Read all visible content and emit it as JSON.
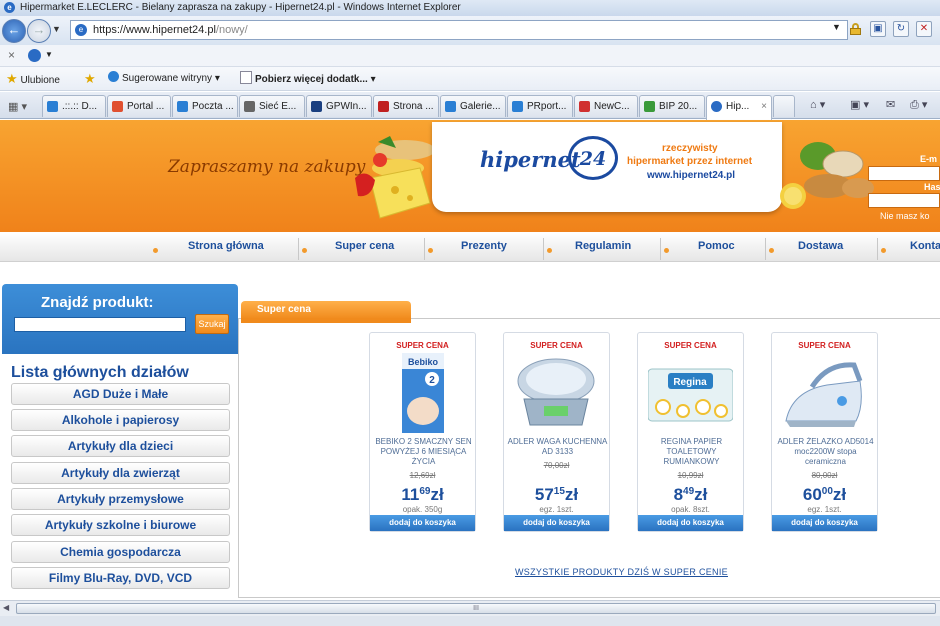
{
  "browser": {
    "window_title": "Hipermarket E.LECLERC - Bielany zaprasza na zakupy - Hipernet24.pl - Windows Internet Explorer",
    "url_prefix": "https://www.",
    "url_domain": "hipernet24.pl",
    "url_path": "/nowy/",
    "favorites_label": "Ulubione",
    "fav_suggested": "Sugerowane witryny",
    "fav_addons": "Pobierz więcej dodatk...",
    "tabs": [
      {
        "label": ".::.:: D..."
      },
      {
        "label": "Portal ..."
      },
      {
        "label": "Poczta ..."
      },
      {
        "label": "Sieć E..."
      },
      {
        "label": "GPWIn..."
      },
      {
        "label": "Strona ..."
      },
      {
        "label": "Galerie..."
      },
      {
        "label": "PRport..."
      },
      {
        "label": "NewC..."
      },
      {
        "label": "BIP 20..."
      },
      {
        "label": "Hip..."
      }
    ],
    "scroll_grip": "III"
  },
  "header": {
    "welcome": "Zapraszamy na zakupy",
    "logo_word": "hipernet",
    "logo_number": "24",
    "tagline_1": "rzeczywisty",
    "tagline_2": "hipermarket przez internet",
    "tagline_3": "www.hipernet24.pl",
    "login_email_label": "E-m",
    "login_pass_label": "Has",
    "login_note": "Nie masz ko"
  },
  "menu": [
    "Strona główna",
    "Super cena",
    "Prezenty",
    "Regulamin",
    "Pomoc",
    "Dostawa",
    "Konta"
  ],
  "search": {
    "title": "Znajdź produkt:",
    "button": "Szukaj",
    "value": ""
  },
  "categories": {
    "title": "Lista głównych działów",
    "items": [
      "AGD Duże i Małe",
      "Alkohole i papierosy",
      "Artykuły dla dzieci",
      "Artykuły dla zwierząt",
      "Artykuły przemysłowe",
      "Artykuły szkolne i biurowe",
      "Chemia gospodarcza",
      "Filmy Blu-Ray, DVD, VCD"
    ]
  },
  "main": {
    "section_tab": "Super cena",
    "all_link": "WSZYSTKIE PRODUKTY DZIŚ W SUPER CENIE",
    "products": [
      {
        "badge": "SUPER CENA",
        "name": "BEBIKO 2 SMACZNY SEN POWYŻEJ 6 MIESIĄCA ŻYCIA",
        "old_price": "12,69zł",
        "price_int": "11",
        "price_dec": "69",
        "currency": "zł",
        "pack": "opak. 350g",
        "add": "dodaj do koszyka",
        "image": "milk-formula-box"
      },
      {
        "badge": "SUPER CENA",
        "name": "ADLER WAGA KUCHENNA AD 3133",
        "old_price": "70,00zł",
        "price_int": "57",
        "price_dec": "15",
        "currency": "zł",
        "pack": "egz. 1szt.",
        "add": "dodaj do koszyka",
        "image": "kitchen-scale"
      },
      {
        "badge": "SUPER CENA",
        "name": "REGINA PAPIER TOALETOWY RUMIANKOWY",
        "old_price": "10,99zł",
        "price_int": "8",
        "price_dec": "49",
        "currency": "zł",
        "pack": "opak. 8szt.",
        "add": "dodaj do koszyka",
        "image": "toilet-paper-pack"
      },
      {
        "badge": "SUPER CENA",
        "name": "ADLER ŻELAZKO AD5014 moc2200W stopa ceramiczna",
        "old_price": "80,00zł",
        "price_int": "60",
        "price_dec": "00",
        "currency": "zł",
        "pack": "egz. 1szt.",
        "add": "dodaj do koszyka",
        "image": "steam-iron"
      }
    ]
  },
  "colors": {
    "header_orange": "#f0821a",
    "brand_blue": "#1d4f9c",
    "price_red": "#d21f1f",
    "panel_blue": "#2a74c0"
  }
}
